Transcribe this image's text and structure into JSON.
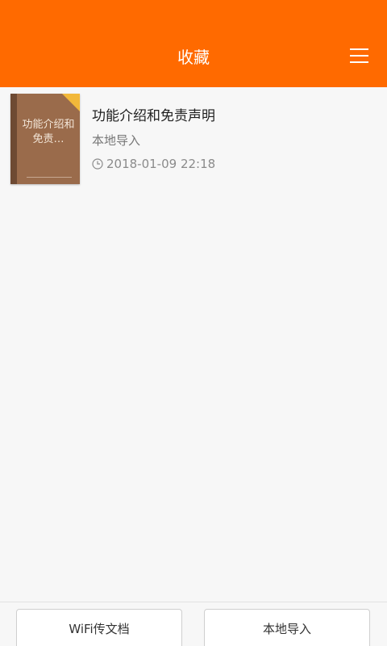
{
  "header": {
    "title": "收藏",
    "menu_icon": "hamburger-menu-icon",
    "background": "#ff6a00"
  },
  "books": [
    {
      "cover_title": "功能介绍和免责…",
      "title": "功能介绍和免责声明",
      "source": "本地导入",
      "date": "2018-01-09 22:18",
      "clock_icon": "clock-icon"
    }
  ],
  "footer": {
    "wifi_label": "WiFi传文档",
    "local_import_label": "本地导入"
  }
}
